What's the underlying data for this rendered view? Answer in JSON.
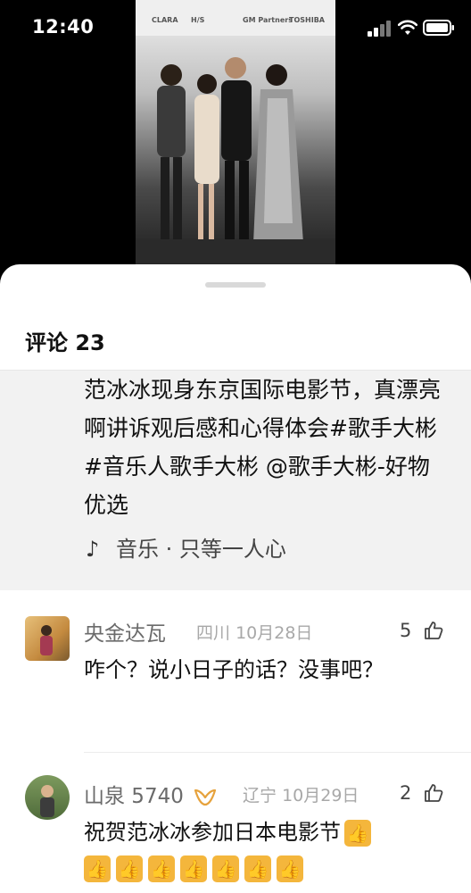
{
  "status_bar": {
    "time": "12:40"
  },
  "video": {
    "sponsors": [
      "CLARA",
      "H/S",
      "GM Partners",
      "TOSHIBA"
    ]
  },
  "comments_panel": {
    "title": "评论 23",
    "caption": {
      "text": "范冰冰现身东京国际电影节，真漂亮啊讲诉观后感和心得体会#歌手大彬 #音乐人歌手大彬 @歌手大彬-好物优选",
      "music": "音乐 · 只等一人心"
    },
    "comments": [
      {
        "user": "央金达瓦",
        "location": "四川",
        "date": "10月28日",
        "likes": "5",
        "text": "咋个？说小日子的话？没事吧？"
      },
      {
        "user": "山泉 5740",
        "location": "辽宁",
        "date": "10月29日",
        "likes": "2",
        "text": "祝贺范冰冰参加日本电影节"
      }
    ]
  },
  "colors": {
    "sheet_bg": "#ffffff",
    "caption_bg": "#f2f2f2",
    "username": "#6b6b6b",
    "meta": "#a8a8a8",
    "badge_gold": "#e6a23c"
  }
}
